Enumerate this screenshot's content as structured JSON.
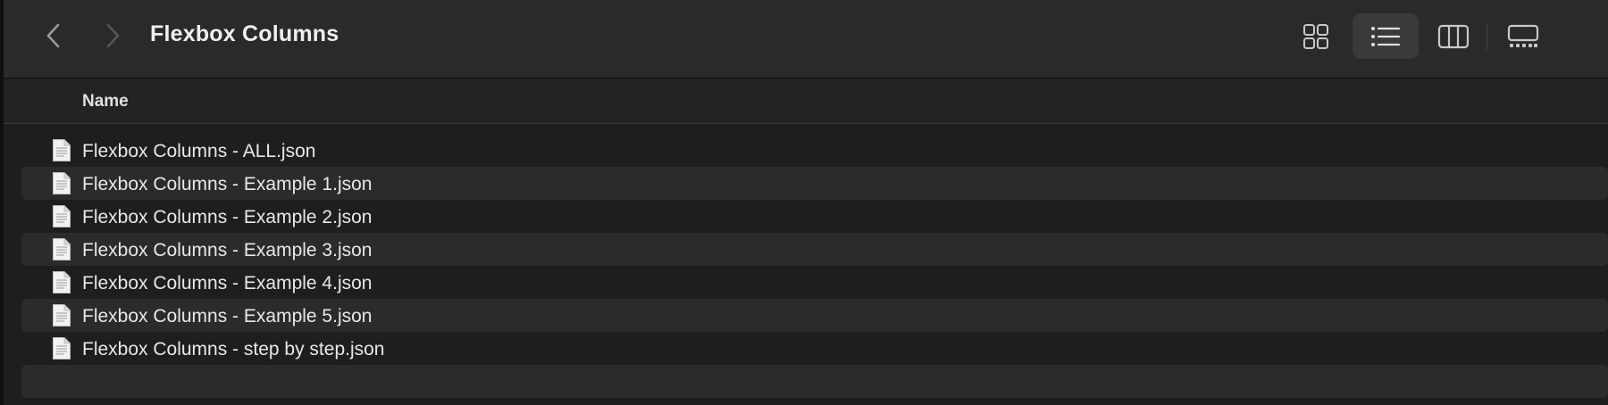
{
  "toolbar": {
    "title": "Flexbox Columns",
    "back_icon": "chevron-left-icon",
    "forward_icon": "chevron-right-icon",
    "view_modes": [
      "icon-view",
      "list-view",
      "column-view",
      "gallery-view"
    ],
    "active_view": "list-view"
  },
  "header": {
    "name_column": "Name"
  },
  "files": [
    {
      "name": "Flexbox Columns - ALL.json",
      "icon": "document-icon"
    },
    {
      "name": "Flexbox Columns - Example 1.json",
      "icon": "document-icon"
    },
    {
      "name": "Flexbox Columns - Example 2.json",
      "icon": "document-icon"
    },
    {
      "name": "Flexbox Columns - Example 3.json",
      "icon": "document-icon"
    },
    {
      "name": "Flexbox Columns - Example 4.json",
      "icon": "document-icon"
    },
    {
      "name": "Flexbox Columns - Example 5.json",
      "icon": "document-icon"
    },
    {
      "name": "Flexbox Columns - step by step.json",
      "icon": "document-icon"
    }
  ],
  "colors": {
    "toolbar_bg": "#2a2a2a",
    "list_bg": "#1e1e1e",
    "alt_row_bg": "#2b2b2b",
    "active_view_bg": "#3a3a3a"
  }
}
